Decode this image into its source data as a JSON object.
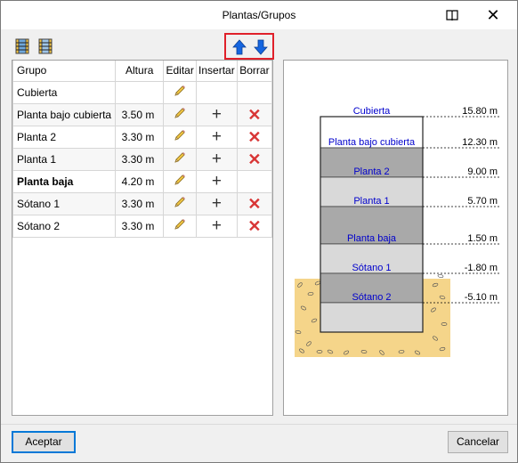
{
  "window": {
    "title": "Plantas/Grupos",
    "book_icon": "book-icon",
    "close_icon": "close-icon"
  },
  "toolbar": {
    "icons": [
      "floor-grid-icon",
      "floor-grid-add-icon"
    ],
    "move_up_icon": "arrow-up-icon",
    "move_down_icon": "arrow-down-icon"
  },
  "table": {
    "headers": {
      "grupo": "Grupo",
      "altura": "Altura",
      "editar": "Editar",
      "insertar": "Insertar",
      "borrar": "Borrar"
    },
    "rows": [
      {
        "grupo": "Cubierta",
        "altura": "",
        "bold": false,
        "insertar": false,
        "borrar": false
      },
      {
        "grupo": "Planta bajo cubierta",
        "altura": "3.50 m",
        "bold": false,
        "insertar": true,
        "borrar": true
      },
      {
        "grupo": "Planta 2",
        "altura": "3.30 m",
        "bold": false,
        "insertar": true,
        "borrar": true
      },
      {
        "grupo": "Planta 1",
        "altura": "3.30 m",
        "bold": false,
        "insertar": true,
        "borrar": true
      },
      {
        "grupo": "Planta baja",
        "altura": "4.20 m",
        "bold": true,
        "insertar": true,
        "borrar": false
      },
      {
        "grupo": "Sótano 1",
        "altura": "3.30 m",
        "bold": false,
        "insertar": true,
        "borrar": true
      },
      {
        "grupo": "Sótano 2",
        "altura": "3.30 m",
        "bold": false,
        "insertar": true,
        "borrar": true
      }
    ]
  },
  "diagram": {
    "levels": [
      {
        "name": "Cubierta",
        "elevation": "15.80 m",
        "value": 15.8
      },
      {
        "name": "Planta bajo cubierta",
        "elevation": "12.30 m",
        "value": 12.3
      },
      {
        "name": "Planta 2",
        "elevation": "9.00 m",
        "value": 9.0
      },
      {
        "name": "Planta 1",
        "elevation": "5.70 m",
        "value": 5.7
      },
      {
        "name": "Planta baja",
        "elevation": "1.50 m",
        "value": 1.5
      },
      {
        "name": "Sótano 1",
        "elevation": "-1.80 m",
        "value": -1.8
      },
      {
        "name": "Sótano 2",
        "elevation": "-5.10 m",
        "value": -5.1
      }
    ],
    "base_value": -8.4,
    "colors": {
      "band_dark": "#a9a9a9",
      "band_light": "#d9d9d9",
      "label": "#0000cc",
      "soil": "#f5d58a"
    }
  },
  "buttons": {
    "accept": "Aceptar",
    "cancel": "Cancelar"
  }
}
